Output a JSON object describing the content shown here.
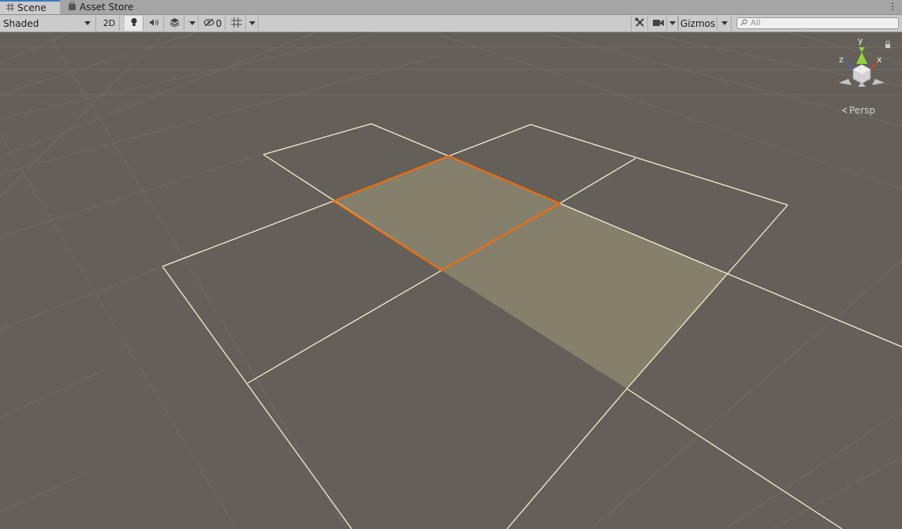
{
  "tabs": [
    {
      "label": "Scene",
      "icon": "grid-icon",
      "active": true
    },
    {
      "label": "Asset Store",
      "icon": "bag-icon",
      "active": false
    }
  ],
  "toolbar": {
    "draw_mode": "Shaded",
    "mode_2d": "2D",
    "hidden_count": "0",
    "gizmos_label": "Gizmos",
    "search_placeholder": "All"
  },
  "gizmo": {
    "y_label": "y",
    "x_label": "x",
    "z_label": "z",
    "projection_label": "Persp"
  },
  "colors": {
    "tab_accent": "#3a79bb",
    "scene_bg": "#646059",
    "selection_outline": "#ff6a00",
    "axis_x": "#e0402a",
    "axis_y": "#8fd43b",
    "axis_z": "#3d6fe8"
  }
}
